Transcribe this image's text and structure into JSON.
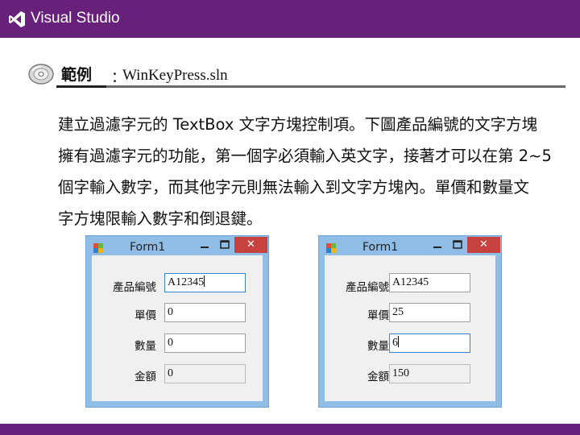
{
  "header": {
    "logo_text": "Visual Studio",
    "bg_color": "#68217a"
  },
  "example": {
    "heading": "範例",
    "colon": "：",
    "filename": "WinKeyPress.sln"
  },
  "paragraph": {
    "lines": [
      "建立過濾字元的 TextBox 文字方塊控制項。下圖產品編號的文字方塊",
      "擁有過濾字元的功能，第一個字必須輸入英文字，接著才可以在第 2~5",
      "個字輸入數字，而其他字元則無法輸入到文字方塊內。單價和數量文",
      "字方塊限輸入數字和倒退鍵。"
    ]
  },
  "window1": {
    "title": "Form1",
    "close_glyph": "✕",
    "labels": {
      "product_id": "產品編號",
      "unit_price": "單價",
      "quantity": "數量",
      "amount": "金額"
    },
    "values": {
      "product_id": "A12345",
      "unit_price": "0",
      "quantity": "0",
      "amount": "0"
    }
  },
  "window2": {
    "title": "Form1",
    "close_glyph": "✕",
    "labels": {
      "product_id": "產品編號",
      "unit_price": "單價",
      "quantity": "數量",
      "amount": "金額"
    },
    "values": {
      "product_id": "A12345",
      "unit_price": "25",
      "quantity": "6",
      "amount": "150"
    }
  }
}
